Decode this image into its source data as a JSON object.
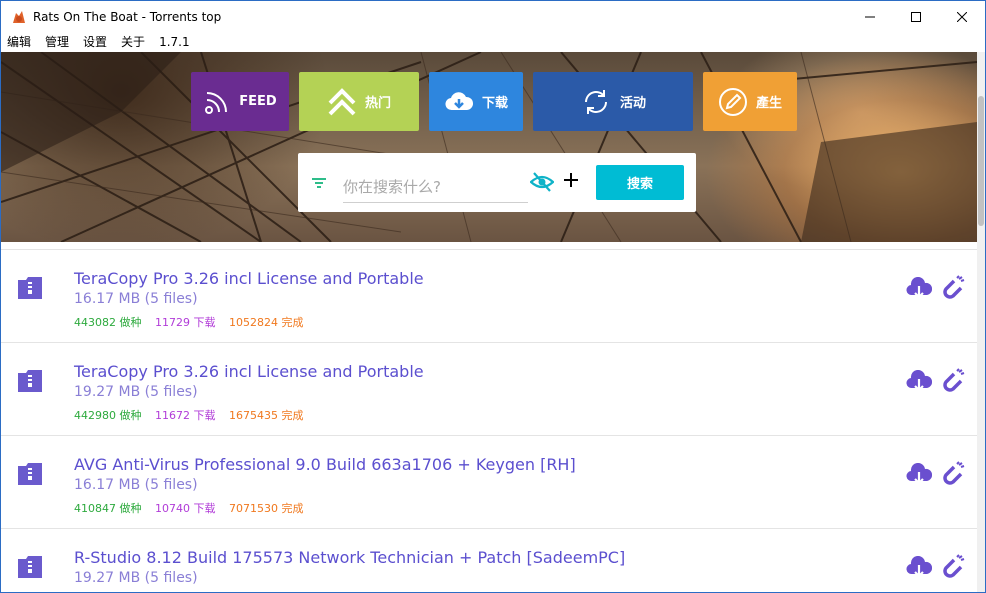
{
  "window": {
    "title": "Rats On The Boat - Torrents top"
  },
  "menu": {
    "items": [
      "编辑",
      "管理",
      "设置",
      "关于",
      "1.7.1"
    ]
  },
  "nav": {
    "feed": "FEED",
    "hot": "热门",
    "download": "下载",
    "activity": "活动",
    "produce": "產生"
  },
  "search": {
    "placeholder": "你在搜索什么?",
    "button": "搜索"
  },
  "colors": {
    "accent": "#00bcd4",
    "title_link": "#5b4fcf",
    "seeders": "#2eaa3e",
    "leechers": "#b13cd8",
    "completed": "#f0781e"
  },
  "torrents": [
    {
      "name": "TeraCopy Pro 3.26 incl License and Portable",
      "size": "16.17 MB (5 files)",
      "seeders": "443082 做种",
      "leechers": "11729 下载",
      "completed": "1052824 完成"
    },
    {
      "name": "TeraCopy Pro 3.26 incl License and Portable",
      "size": "19.27 MB (5 files)",
      "seeders": "442980 做种",
      "leechers": "11672 下载",
      "completed": "1675435 完成"
    },
    {
      "name": "AVG Anti-Virus Professional 9.0 Build 663a1706 + Keygen [RH]",
      "size": "16.17 MB (5 files)",
      "seeders": "410847 做种",
      "leechers": "10740 下载",
      "completed": "7071530 完成"
    },
    {
      "name": "R-Studio 8.12 Build 175573 Network Technician + Patch [SadeemPC]",
      "size": "19.27 MB (5 files)",
      "seeders": "",
      "leechers": "",
      "completed": ""
    }
  ]
}
